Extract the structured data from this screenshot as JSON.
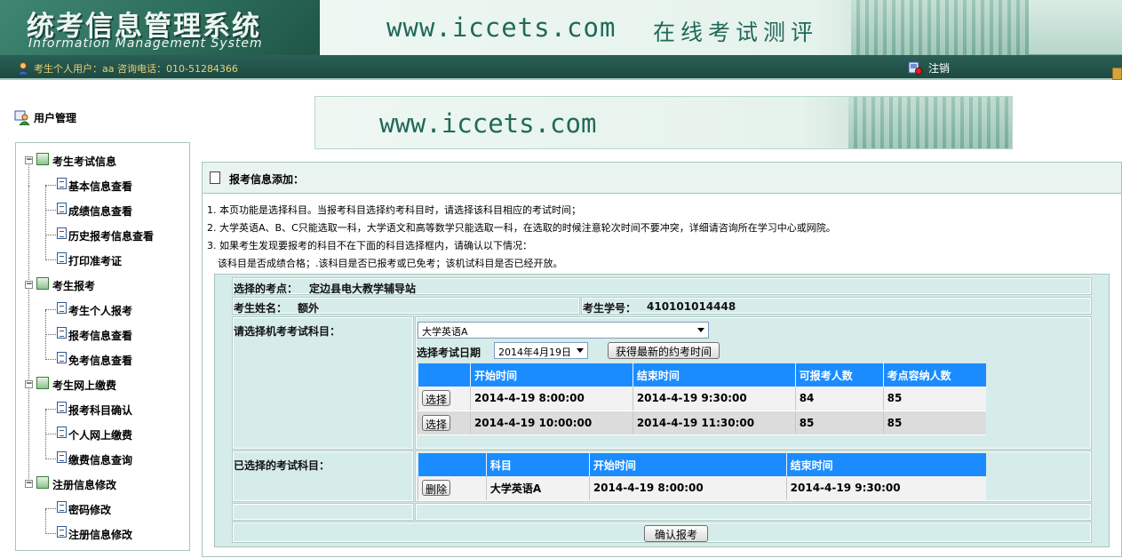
{
  "header": {
    "title": "统考信息管理系统",
    "subtitle": "Information Management System",
    "banner_url": "www.iccets.com",
    "banner_slogan": "在线考试测评"
  },
  "userbar": {
    "user_info": "考生个人用户：aa 咨询电话：010-51284366",
    "logout": "注销"
  },
  "sidebar": {
    "title": "用户管理",
    "groups": [
      {
        "label": "考生考试信息",
        "items": [
          "基本信息查看",
          "成绩信息查看",
          "历史报考信息查看",
          "打印准考证"
        ]
      },
      {
        "label": "考生报考",
        "items": [
          "考生个人报考",
          "报考信息查看",
          "免考信息查看"
        ]
      },
      {
        "label": "考生网上缴费",
        "items": [
          "报考科目确认",
          "个人网上缴费",
          "缴费信息查询"
        ]
      },
      {
        "label": "注册信息修改",
        "items": [
          "密码修改",
          "注册信息修改"
        ]
      }
    ]
  },
  "main": {
    "banner_url": "www.iccets.com",
    "panel_title": "报考信息添加：",
    "notes": [
      "1. 本页功能是选择科目。当报考科目选择约考科目时，请选择该科目相应的考试时间；",
      "2. 大学英语A、B、C只能选取一科，大学语文和高等数学只能选取一科，在选取的时候注意轮次时间不要冲突，详细请咨询所在学习中心或网院。",
      "3. 如果考生发现要报考的科目不在下面的科目选择框内，请确认以下情况：",
      "该科目是否成绩合格；.该科目是否已报考或已免考；该机试科目是否已经开放。"
    ],
    "form": {
      "site_label": "选择的考点：",
      "site_value": "定边县电大教学辅导站",
      "name_label": "考生姓名：",
      "name_value": "额外",
      "id_label": "考生学号：",
      "id_value": "410101014448",
      "subject_label": "请选择机考考试科目：",
      "subject_selected": "大学英语A",
      "date_label": "选择考试日期",
      "date_selected": "2014年4月19日",
      "refresh_button": "获得最新的约考时间",
      "slots_headers": [
        "开始时间",
        "结束时间",
        "可报考人数",
        "考点容纳人数"
      ],
      "slots": [
        {
          "action": "选择",
          "start": "2014-4-19 8:00:00",
          "end": "2014-4-19 9:30:00",
          "available": "84",
          "capacity": "85"
        },
        {
          "action": "选择",
          "start": "2014-4-19 10:00:00",
          "end": "2014-4-19 11:30:00",
          "available": "85",
          "capacity": "85"
        }
      ],
      "selected_label": "已选择的考试科目：",
      "selected_headers": [
        "科目",
        "开始时间",
        "结束时间"
      ],
      "selected": [
        {
          "action": "删除",
          "subject": "大学英语A",
          "start": "2014-4-19 8:00:00",
          "end": "2014-4-19 9:30:00"
        }
      ],
      "confirm_button": "确认报考"
    }
  },
  "colors": {
    "header_green": "#2b6a58",
    "userbar": "#1d4a42",
    "table_header_blue": "#1a8cff",
    "form_bg": "#d6ecea"
  }
}
